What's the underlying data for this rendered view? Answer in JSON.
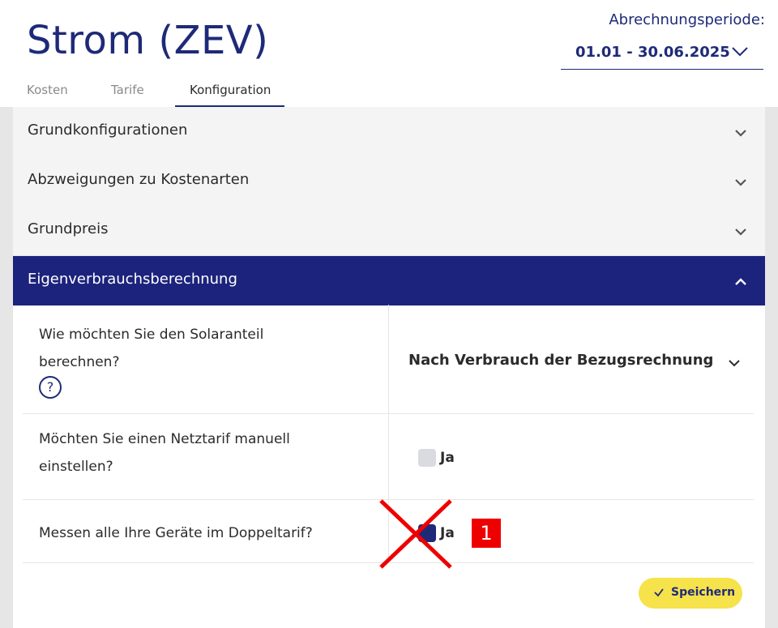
{
  "header": {
    "title": "Strom (ZEV)",
    "period_label": "Abrechnungsperiode:",
    "period_value": "01.01 - 30.06.2025"
  },
  "tabs": [
    {
      "label": "Kosten",
      "active": false
    },
    {
      "label": "Tarife",
      "active": false
    },
    {
      "label": "Konfiguration",
      "active": true
    }
  ],
  "accordion": [
    {
      "label": "Grundkonfigurationen",
      "open": false
    },
    {
      "label": "Abzweigungen zu Kostenarten",
      "open": false
    },
    {
      "label": "Grundpreis",
      "open": false
    },
    {
      "label": "Eigenverbrauchsberechnung",
      "open": true
    }
  ],
  "questions": {
    "solar": {
      "line1": "Wie möchten Sie den Solaranteil",
      "line2": "berechnen?",
      "help": "?",
      "selected": "Nach Verbrauch der Bezugsrechnung"
    },
    "netztarif": {
      "line1": "Möchten Sie einen Netztarif manuell",
      "line2": "einstellen?",
      "option": "Ja",
      "checked": false
    },
    "doppeltarif": {
      "line1": "Messen alle Ihre Geräte im Doppeltarif?",
      "option": "Ja",
      "checked": true
    }
  },
  "save_label": "Speichern",
  "annotation": {
    "marker": "1",
    "color": "#ee0000"
  },
  "colors": {
    "primary": "#1e2a78",
    "accent": "#f6e24b"
  }
}
